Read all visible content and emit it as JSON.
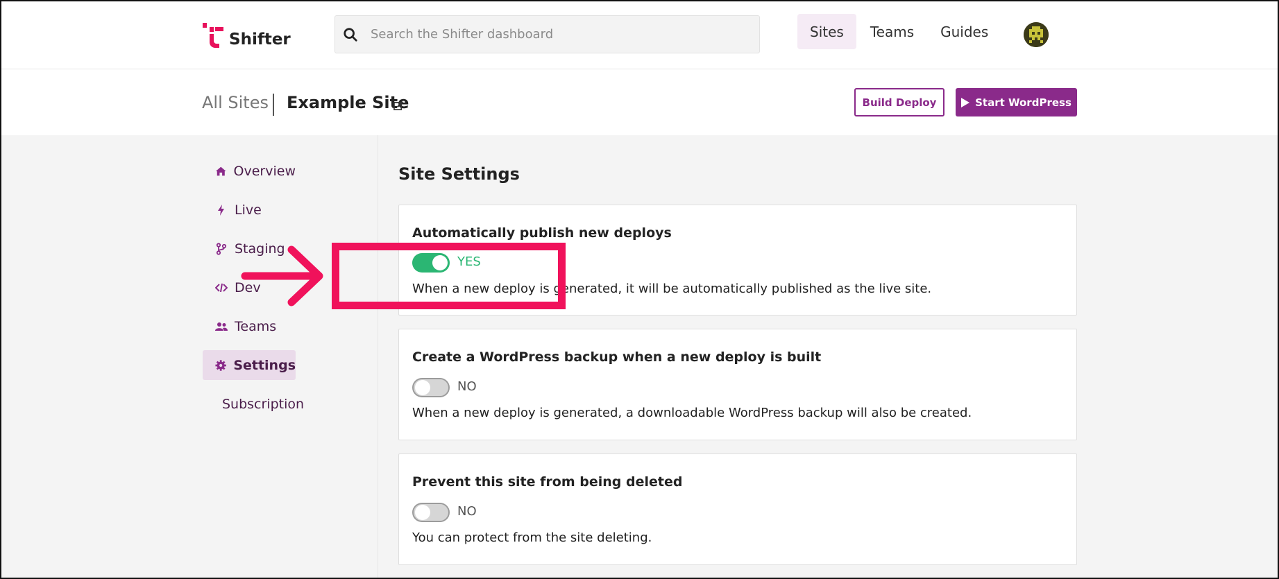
{
  "logo": {
    "text": "Shifter"
  },
  "search": {
    "placeholder": "Search the Shifter dashboard"
  },
  "nav": {
    "items": [
      {
        "label": "Sites",
        "active": true
      },
      {
        "label": "Teams",
        "active": false
      },
      {
        "label": "Guides",
        "active": false
      }
    ]
  },
  "breadcrumb": {
    "all": "All Sites",
    "site": "Example Site"
  },
  "actions": {
    "build": "Build Deploy",
    "start": "Start WordPress"
  },
  "sidebar": {
    "items": [
      {
        "label": "Overview",
        "icon": "home-icon"
      },
      {
        "label": "Live",
        "icon": "bolt-icon"
      },
      {
        "label": "Staging",
        "icon": "branch-icon"
      },
      {
        "label": "Dev",
        "icon": "code-icon"
      },
      {
        "label": "Teams",
        "icon": "users-icon"
      },
      {
        "label": "Settings",
        "icon": "gear-icon",
        "active": true
      },
      {
        "label": "Subscription",
        "icon": "card-icon"
      }
    ]
  },
  "main": {
    "title": "Site Settings",
    "settings": [
      {
        "title": "Automatically publish new deploys",
        "state": "YES",
        "on": true,
        "description": "When a new deploy is generated, it will be automatically published as the live site."
      },
      {
        "title": "Create a WordPress backup when a new deploy is built",
        "state": "NO",
        "on": false,
        "description": "When a new deploy is generated, a downloadable WordPress backup will also be created."
      },
      {
        "title": "Prevent this site from being deleted",
        "state": "NO",
        "on": false,
        "description": "You can protect from the site deleting."
      }
    ]
  },
  "colors": {
    "brand": "#8a2a8a",
    "toggle_on": "#2bb673",
    "annotation": "#f0125b",
    "logo": "#e8115b"
  }
}
